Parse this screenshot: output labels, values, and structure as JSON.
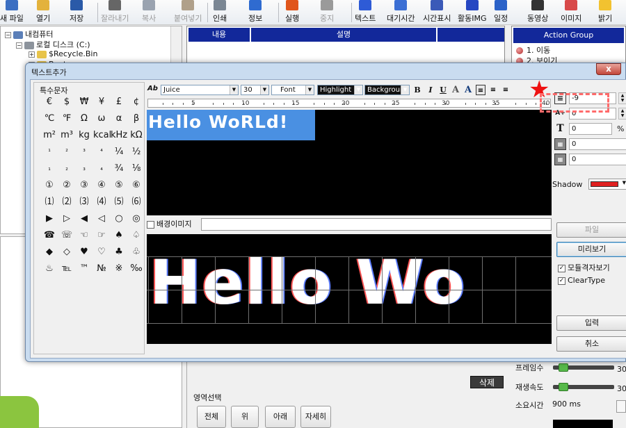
{
  "toolbar": {
    "items": [
      {
        "label": "새 파일",
        "icon": "new-file-icon",
        "color": "#3c6fc2",
        "enabled": true
      },
      {
        "label": "열기",
        "icon": "open-folder-icon",
        "color": "#e3b23c",
        "enabled": true
      },
      {
        "label": "저장",
        "icon": "save-icon",
        "color": "#2a5aa8",
        "enabled": true
      },
      {
        "label": "잘라내기",
        "icon": "cut-icon",
        "color": "#666666",
        "enabled": false
      },
      {
        "label": "복사",
        "icon": "copy-icon",
        "color": "#9aa3b0",
        "enabled": false
      },
      {
        "label": "붙여넣기",
        "icon": "paste-icon",
        "color": "#b0a08a",
        "enabled": false
      },
      {
        "label": "인쇄",
        "icon": "print-icon",
        "color": "#7b8794",
        "enabled": true
      },
      {
        "label": "정보",
        "icon": "info-icon",
        "color": "#2f6bd0",
        "enabled": true
      },
      {
        "label": "실행",
        "icon": "run-icon",
        "color": "#e0561b",
        "enabled": true
      },
      {
        "label": "중지",
        "icon": "stop-icon",
        "color": "#9a9a9a",
        "enabled": false
      },
      {
        "label": "텍스트",
        "icon": "text-icon",
        "color": "#2e5bd6",
        "enabled": true
      },
      {
        "label": "대기시간",
        "icon": "wait-time-icon",
        "color": "#3b6fd4",
        "enabled": true
      },
      {
        "label": "시간표시",
        "icon": "clock-icon",
        "color": "#3b5ab8",
        "enabled": true
      },
      {
        "label": "활동IMG",
        "icon": "animated-image-icon",
        "color": "#2747c2",
        "enabled": true
      },
      {
        "label": "일정",
        "icon": "schedule-icon",
        "color": "#2b62c8",
        "enabled": true
      },
      {
        "label": "동영상",
        "icon": "video-icon",
        "color": "#333333",
        "enabled": true
      },
      {
        "label": "이미지",
        "icon": "image-icon",
        "color": "#d84a4a",
        "enabled": true
      },
      {
        "label": "밝기",
        "icon": "brightness-icon",
        "color": "#f2c230",
        "enabled": true
      }
    ]
  },
  "tree": {
    "root": "내컴퓨터",
    "drive": "로컬 디스크 (C:)",
    "recycle": "$Recycle.Bin",
    "partial": "Boot"
  },
  "list_panel": {
    "col1": "내용",
    "col2": "설명"
  },
  "action_panel": {
    "title": "Action Group",
    "items": [
      "1. 이동",
      "2. 보이기"
    ]
  },
  "dialog": {
    "title": "텍스트추가",
    "close": "x",
    "special_chars_label": "특수문자",
    "special_chars": [
      [
        "€",
        "$",
        "₩",
        "¥",
        "£",
        "¢"
      ],
      [
        "℃",
        "℉",
        "Ω",
        "ω",
        "α",
        "β"
      ],
      [
        "m²",
        "m³",
        "kg",
        "kcal",
        "kHz",
        "kΩ"
      ],
      [
        "¹",
        "²",
        "³",
        "⁴",
        "¼",
        "½"
      ],
      [
        "₁",
        "₂",
        "₃",
        "₄",
        "¾",
        "⅛"
      ],
      [
        "①",
        "②",
        "③",
        "④",
        "⑤",
        "⑥"
      ],
      [
        "⑴",
        "⑵",
        "⑶",
        "⑷",
        "⑸",
        "⑹"
      ],
      [
        "▶",
        "▷",
        "◀",
        "◁",
        "○",
        "◎"
      ],
      [
        "☎",
        "☏",
        "☜",
        "☞",
        "♠",
        "♤"
      ],
      [
        "◆",
        "◇",
        "♥",
        "♡",
        "♣",
        "♧"
      ],
      [
        "♨",
        "℡",
        "™",
        "№",
        "※",
        "‰"
      ]
    ],
    "format": {
      "font_prefix": "Ab",
      "font_name": "Juice",
      "font_size": "30",
      "font_dd": "Font",
      "highlight": "Highlight",
      "background": "Background",
      "bold": "B",
      "italic": "I",
      "underline": "U"
    },
    "ruler_numbers": [
      "5",
      "10",
      "15",
      "20",
      "25",
      "30",
      "35",
      "40"
    ],
    "editor_text": "Hello WoRLd!",
    "bg_image_label": "배경이미지",
    "preview_text": "Hello Wo",
    "right": {
      "spacing_value": "-9",
      "field2": "0",
      "field3": "0",
      "field3_unit": "%",
      "field4": "0",
      "field5": "0",
      "shadow_label": "Shadow",
      "shadow_color": "#e02020",
      "file_button": "파일",
      "preview_button": "미리보기",
      "checkbox1": "모듈격자보기",
      "checkbox2": "ClearType",
      "enter_button": "입력",
      "cancel_button": "취소"
    }
  },
  "bottom": {
    "delete_label": "삭제",
    "area_select": "영역선택",
    "buttons": [
      "전체",
      "위",
      "아래",
      "자세히"
    ]
  },
  "status": {
    "frame_label": "프레임수",
    "frame_value": "30",
    "speed_label": "재생속도",
    "speed_value": "30",
    "duration_label": "소요시간",
    "duration_value": "900 ms"
  }
}
